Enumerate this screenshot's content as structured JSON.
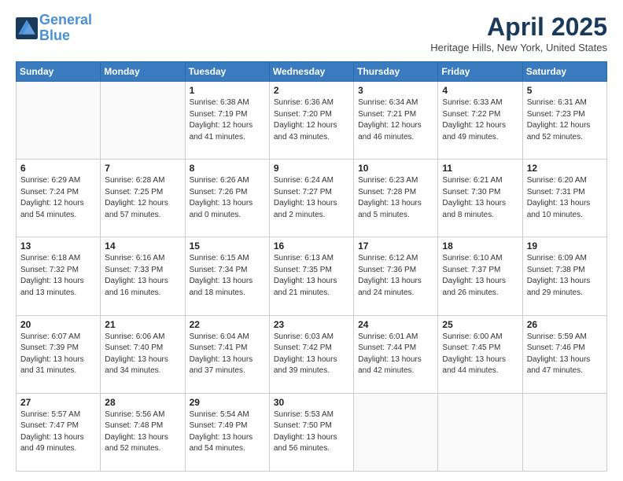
{
  "logo": {
    "line1": "General",
    "line2": "Blue"
  },
  "title": "April 2025",
  "location": "Heritage Hills, New York, United States",
  "headers": [
    "Sunday",
    "Monday",
    "Tuesday",
    "Wednesday",
    "Thursday",
    "Friday",
    "Saturday"
  ],
  "weeks": [
    [
      {
        "day": "",
        "sunrise": "",
        "sunset": "",
        "daylight": ""
      },
      {
        "day": "",
        "sunrise": "",
        "sunset": "",
        "daylight": ""
      },
      {
        "day": "1",
        "sunrise": "Sunrise: 6:38 AM",
        "sunset": "Sunset: 7:19 PM",
        "daylight": "Daylight: 12 hours and 41 minutes."
      },
      {
        "day": "2",
        "sunrise": "Sunrise: 6:36 AM",
        "sunset": "Sunset: 7:20 PM",
        "daylight": "Daylight: 12 hours and 43 minutes."
      },
      {
        "day": "3",
        "sunrise": "Sunrise: 6:34 AM",
        "sunset": "Sunset: 7:21 PM",
        "daylight": "Daylight: 12 hours and 46 minutes."
      },
      {
        "day": "4",
        "sunrise": "Sunrise: 6:33 AM",
        "sunset": "Sunset: 7:22 PM",
        "daylight": "Daylight: 12 hours and 49 minutes."
      },
      {
        "day": "5",
        "sunrise": "Sunrise: 6:31 AM",
        "sunset": "Sunset: 7:23 PM",
        "daylight": "Daylight: 12 hours and 52 minutes."
      }
    ],
    [
      {
        "day": "6",
        "sunrise": "Sunrise: 6:29 AM",
        "sunset": "Sunset: 7:24 PM",
        "daylight": "Daylight: 12 hours and 54 minutes."
      },
      {
        "day": "7",
        "sunrise": "Sunrise: 6:28 AM",
        "sunset": "Sunset: 7:25 PM",
        "daylight": "Daylight: 12 hours and 57 minutes."
      },
      {
        "day": "8",
        "sunrise": "Sunrise: 6:26 AM",
        "sunset": "Sunset: 7:26 PM",
        "daylight": "Daylight: 13 hours and 0 minutes."
      },
      {
        "day": "9",
        "sunrise": "Sunrise: 6:24 AM",
        "sunset": "Sunset: 7:27 PM",
        "daylight": "Daylight: 13 hours and 2 minutes."
      },
      {
        "day": "10",
        "sunrise": "Sunrise: 6:23 AM",
        "sunset": "Sunset: 7:28 PM",
        "daylight": "Daylight: 13 hours and 5 minutes."
      },
      {
        "day": "11",
        "sunrise": "Sunrise: 6:21 AM",
        "sunset": "Sunset: 7:30 PM",
        "daylight": "Daylight: 13 hours and 8 minutes."
      },
      {
        "day": "12",
        "sunrise": "Sunrise: 6:20 AM",
        "sunset": "Sunset: 7:31 PM",
        "daylight": "Daylight: 13 hours and 10 minutes."
      }
    ],
    [
      {
        "day": "13",
        "sunrise": "Sunrise: 6:18 AM",
        "sunset": "Sunset: 7:32 PM",
        "daylight": "Daylight: 13 hours and 13 minutes."
      },
      {
        "day": "14",
        "sunrise": "Sunrise: 6:16 AM",
        "sunset": "Sunset: 7:33 PM",
        "daylight": "Daylight: 13 hours and 16 minutes."
      },
      {
        "day": "15",
        "sunrise": "Sunrise: 6:15 AM",
        "sunset": "Sunset: 7:34 PM",
        "daylight": "Daylight: 13 hours and 18 minutes."
      },
      {
        "day": "16",
        "sunrise": "Sunrise: 6:13 AM",
        "sunset": "Sunset: 7:35 PM",
        "daylight": "Daylight: 13 hours and 21 minutes."
      },
      {
        "day": "17",
        "sunrise": "Sunrise: 6:12 AM",
        "sunset": "Sunset: 7:36 PM",
        "daylight": "Daylight: 13 hours and 24 minutes."
      },
      {
        "day": "18",
        "sunrise": "Sunrise: 6:10 AM",
        "sunset": "Sunset: 7:37 PM",
        "daylight": "Daylight: 13 hours and 26 minutes."
      },
      {
        "day": "19",
        "sunrise": "Sunrise: 6:09 AM",
        "sunset": "Sunset: 7:38 PM",
        "daylight": "Daylight: 13 hours and 29 minutes."
      }
    ],
    [
      {
        "day": "20",
        "sunrise": "Sunrise: 6:07 AM",
        "sunset": "Sunset: 7:39 PM",
        "daylight": "Daylight: 13 hours and 31 minutes."
      },
      {
        "day": "21",
        "sunrise": "Sunrise: 6:06 AM",
        "sunset": "Sunset: 7:40 PM",
        "daylight": "Daylight: 13 hours and 34 minutes."
      },
      {
        "day": "22",
        "sunrise": "Sunrise: 6:04 AM",
        "sunset": "Sunset: 7:41 PM",
        "daylight": "Daylight: 13 hours and 37 minutes."
      },
      {
        "day": "23",
        "sunrise": "Sunrise: 6:03 AM",
        "sunset": "Sunset: 7:42 PM",
        "daylight": "Daylight: 13 hours and 39 minutes."
      },
      {
        "day": "24",
        "sunrise": "Sunrise: 6:01 AM",
        "sunset": "Sunset: 7:44 PM",
        "daylight": "Daylight: 13 hours and 42 minutes."
      },
      {
        "day": "25",
        "sunrise": "Sunrise: 6:00 AM",
        "sunset": "Sunset: 7:45 PM",
        "daylight": "Daylight: 13 hours and 44 minutes."
      },
      {
        "day": "26",
        "sunrise": "Sunrise: 5:59 AM",
        "sunset": "Sunset: 7:46 PM",
        "daylight": "Daylight: 13 hours and 47 minutes."
      }
    ],
    [
      {
        "day": "27",
        "sunrise": "Sunrise: 5:57 AM",
        "sunset": "Sunset: 7:47 PM",
        "daylight": "Daylight: 13 hours and 49 minutes."
      },
      {
        "day": "28",
        "sunrise": "Sunrise: 5:56 AM",
        "sunset": "Sunset: 7:48 PM",
        "daylight": "Daylight: 13 hours and 52 minutes."
      },
      {
        "day": "29",
        "sunrise": "Sunrise: 5:54 AM",
        "sunset": "Sunset: 7:49 PM",
        "daylight": "Daylight: 13 hours and 54 minutes."
      },
      {
        "day": "30",
        "sunrise": "Sunrise: 5:53 AM",
        "sunset": "Sunset: 7:50 PM",
        "daylight": "Daylight: 13 hours and 56 minutes."
      },
      {
        "day": "",
        "sunrise": "",
        "sunset": "",
        "daylight": ""
      },
      {
        "day": "",
        "sunrise": "",
        "sunset": "",
        "daylight": ""
      },
      {
        "day": "",
        "sunrise": "",
        "sunset": "",
        "daylight": ""
      }
    ]
  ]
}
